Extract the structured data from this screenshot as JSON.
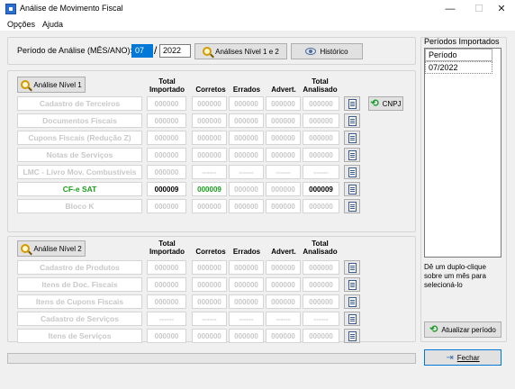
{
  "window": {
    "title": "Análise de Movimento Fiscal",
    "minimize_glyph": "—",
    "maximize_glyph": "☐",
    "close_glyph": "✕"
  },
  "menu": [
    "Opções",
    "Ajuda"
  ],
  "period": {
    "label": "Período de Análise (MÊS/ANO):",
    "month": "07",
    "separator": "/",
    "year": "2022",
    "analises_button": "Análises Nível 1 e 2",
    "historico_button": "Histórico"
  },
  "nivel1": {
    "button": "Análise Nível 1",
    "headers": [
      "Total Importado",
      "Corretos",
      "Errados",
      "Advert.",
      "Total Analisado"
    ],
    "cnpj_button": "CNPJ",
    "rows": [
      {
        "label": "Cadastro de Terceiros",
        "values": [
          "000000",
          "000000",
          "000000",
          "000000",
          "000000"
        ],
        "state": "disabled"
      },
      {
        "label": "Documentos Fiscais",
        "values": [
          "000000",
          "000000",
          "000000",
          "000000",
          "000000"
        ],
        "state": "disabled"
      },
      {
        "label": "Cupons Fiscais (Redução Z)",
        "values": [
          "000000",
          "000000",
          "000000",
          "000000",
          "000000"
        ],
        "state": "disabled"
      },
      {
        "label": "Notas de Serviços",
        "values": [
          "000000",
          "000000",
          "000000",
          "000000",
          "000000"
        ],
        "state": "disabled"
      },
      {
        "label": "LMC - Livro Mov. Combustíveis",
        "values": [
          "000000",
          "------",
          "------",
          "------",
          "------"
        ],
        "state": "disabled"
      },
      {
        "label": "CF-e SAT",
        "values": [
          "000009",
          "000009",
          "000000",
          "000000",
          "000009"
        ],
        "state": "active"
      },
      {
        "label": "Bloco K",
        "values": [
          "000000",
          "000000",
          "000000",
          "000000",
          "000000"
        ],
        "state": "disabled"
      }
    ]
  },
  "nivel2": {
    "button": "Análise Nível 2",
    "headers": [
      "Total Importado",
      "Corretos",
      "Errados",
      "Advert.",
      "Total Analisado"
    ],
    "rows": [
      {
        "label": "Cadastro de Produtos",
        "values": [
          "000000",
          "000000",
          "000000",
          "000000",
          "000000"
        ]
      },
      {
        "label": "Itens de Doc. Fiscais",
        "values": [
          "000000",
          "000000",
          "000000",
          "000000",
          "000000"
        ]
      },
      {
        "label": "Itens de Cupons Fiscais",
        "values": [
          "000000",
          "000000",
          "000000",
          "000000",
          "000000"
        ]
      },
      {
        "label": "Cadastro de Serviços",
        "values": [
          "------",
          "------",
          "------",
          "------",
          "------"
        ]
      },
      {
        "label": "Itens de Serviços",
        "values": [
          "000000",
          "000000",
          "000000",
          "000000",
          "000000"
        ]
      }
    ]
  },
  "periodos": {
    "title": "Períodos Importados",
    "column": "Período",
    "items": [
      "07/2022"
    ],
    "hint": "Dê um duplo-clique sobre um mês para selecioná-lo",
    "atualizar_button": "Atualizar período"
  },
  "fechar_button": "Fechar",
  "colors": {
    "accent": "#0078d7",
    "active_text": "#1a9e1a",
    "disabled_text": "#c8c8c8"
  }
}
